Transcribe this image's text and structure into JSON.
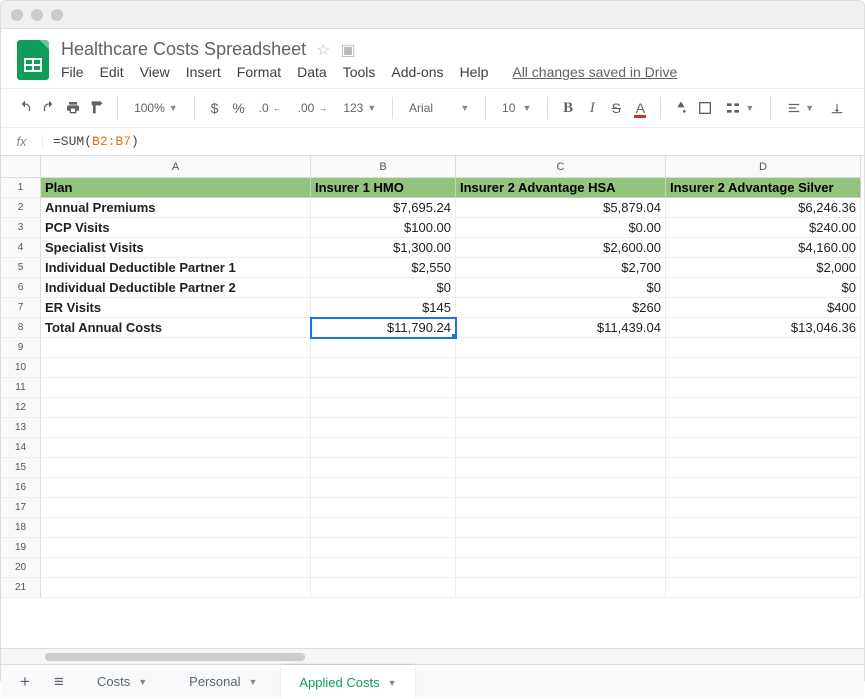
{
  "doc": {
    "title": "Healthcare Costs Spreadsheet",
    "save_status": "All changes saved in Drive"
  },
  "menu": {
    "file": "File",
    "edit": "Edit",
    "view": "View",
    "insert": "Insert",
    "format": "Format",
    "data": "Data",
    "tools": "Tools",
    "addons": "Add-ons",
    "help": "Help"
  },
  "toolbar": {
    "zoom": "100%",
    "currency": "$",
    "percent": "%",
    "dec_less": ".0",
    "dec_more": ".00",
    "numfmt": "123",
    "font": "Arial",
    "size": "10"
  },
  "formula": {
    "prefix": "=SUM(",
    "ref": "B2:B7",
    "suffix": ")"
  },
  "columns": {
    "A": "A",
    "B": "B",
    "C": "C",
    "D": "D"
  },
  "header_row": {
    "plan": "Plan",
    "b": "Insurer 1 HMO",
    "c": "Insurer 2 Advantage HSA",
    "d": "Insurer 2 Advantage Silver"
  },
  "rows": [
    {
      "label": "Annual Premiums",
      "b": "$7,695.24",
      "c": "$5,879.04",
      "d": "$6,246.36"
    },
    {
      "label": "PCP Visits",
      "b": "$100.00",
      "c": "$0.00",
      "d": "$240.00"
    },
    {
      "label": "Specialist Visits",
      "b": "$1,300.00",
      "c": "$2,600.00",
      "d": "$4,160.00"
    },
    {
      "label": "Individual Deductible Partner 1",
      "b": "$2,550",
      "c": "$2,700",
      "d": "$2,000"
    },
    {
      "label": "Individual Deductible Partner 2",
      "b": "$0",
      "c": "$0",
      "d": "$0"
    },
    {
      "label": "ER Visits",
      "b": "$145",
      "c": "$260",
      "d": "$400"
    },
    {
      "label": "Total Annual Costs",
      "b": "$11,790.24",
      "c": "$11,439.04",
      "d": "$13,046.36"
    }
  ],
  "rownums": [
    "1",
    "2",
    "3",
    "4",
    "5",
    "6",
    "7",
    "8",
    "9",
    "10",
    "11",
    "12",
    "13",
    "14",
    "15",
    "16",
    "17",
    "18",
    "19",
    "20",
    "21"
  ],
  "tabs": {
    "costs": "Costs",
    "personal": "Personal",
    "applied": "Applied Costs"
  },
  "chart_data": {
    "type": "table",
    "columns": [
      "Plan",
      "Insurer 1 HMO",
      "Insurer 2 Advantage HSA",
      "Insurer 2 Advantage Silver"
    ],
    "rows": [
      [
        "Annual Premiums",
        7695.24,
        5879.04,
        6246.36
      ],
      [
        "PCP Visits",
        100.0,
        0.0,
        240.0
      ],
      [
        "Specialist Visits",
        1300.0,
        2600.0,
        4160.0
      ],
      [
        "Individual Deductible Partner 1",
        2550,
        2700,
        2000
      ],
      [
        "Individual Deductible Partner 2",
        0,
        0,
        0
      ],
      [
        "ER Visits",
        145,
        260,
        400
      ],
      [
        "Total Annual Costs",
        11790.24,
        11439.04,
        13046.36
      ]
    ]
  }
}
